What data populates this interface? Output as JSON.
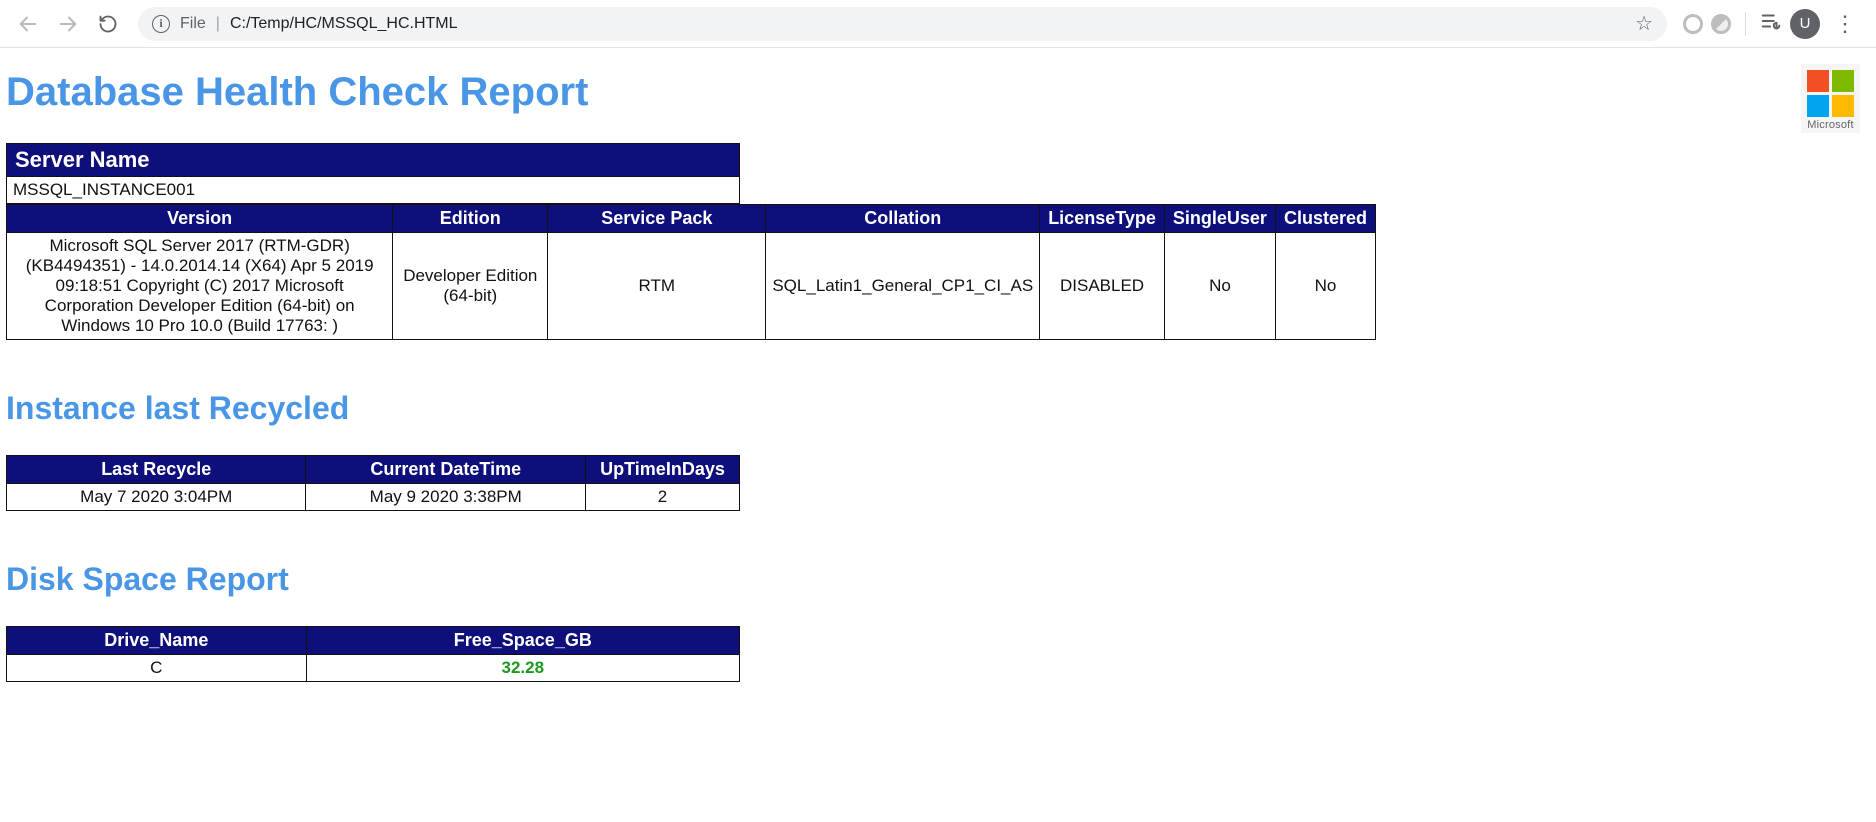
{
  "browser": {
    "omnibox": {
      "file_label": "File",
      "path": "C:/Temp/HC/MSSQL_HC.HTML"
    },
    "avatar_initial": "U"
  },
  "logo": {
    "label": "Microsoft"
  },
  "report": {
    "title": "Database Health Check Report",
    "server_name_table": {
      "header": "Server Name",
      "value": "MSSQL_INSTANCE001"
    },
    "version_table": {
      "headers": [
        "Version",
        "Edition",
        "Service Pack",
        "Collation",
        "LicenseType",
        "SingleUser",
        "Clustered"
      ],
      "row": {
        "version": "Microsoft SQL Server 2017 (RTM-GDR) (KB4494351) - 14.0.2014.14 (X64) Apr 5 2019 09:18:51 Copyright (C) 2017 Microsoft Corporation Developer Edition (64-bit) on Windows 10 Pro 10.0 (Build 17763: )",
        "edition": "Developer Edition (64-bit)",
        "service_pack": "RTM",
        "collation": "SQL_Latin1_General_CP1_CI_AS",
        "license_type": "DISABLED",
        "single_user": "No",
        "clustered": "No"
      }
    },
    "recycle_section": {
      "title": "Instance last Recycled",
      "headers": [
        "Last Recycle",
        "Current DateTime",
        "UpTimeInDays"
      ],
      "row": {
        "last_recycle": "May 7 2020 3:04PM",
        "current_datetime": "May 9 2020 3:38PM",
        "uptime_days": "2"
      }
    },
    "disk_section": {
      "title": "Disk Space Report",
      "headers": [
        "Drive_Name",
        "Free_Space_GB"
      ],
      "row": {
        "drive_name": "C",
        "free_space_gb": "32.28"
      }
    }
  }
}
